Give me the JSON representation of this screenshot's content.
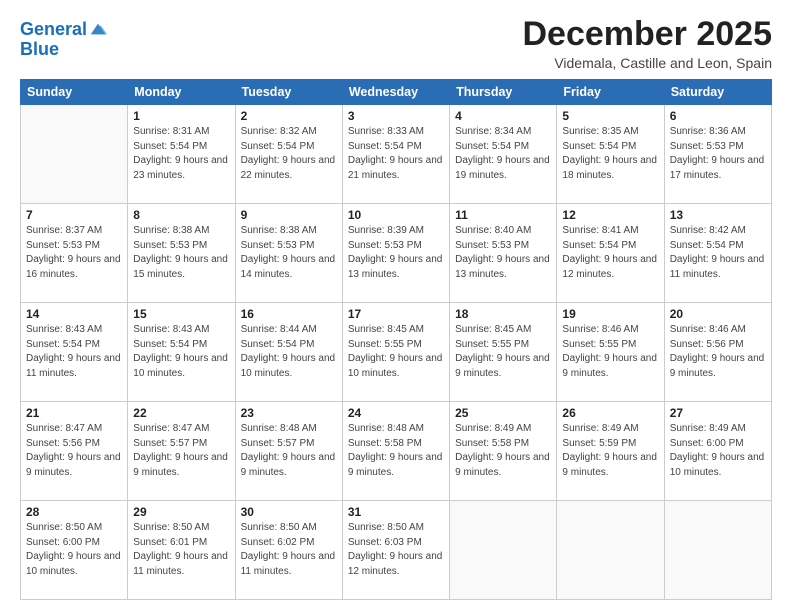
{
  "logo": {
    "line1": "General",
    "line2": "Blue"
  },
  "title": "December 2025",
  "subtitle": "Videmala, Castille and Leon, Spain",
  "weekdays": [
    "Sunday",
    "Monday",
    "Tuesday",
    "Wednesday",
    "Thursday",
    "Friday",
    "Saturday"
  ],
  "weeks": [
    [
      {
        "day": "",
        "info": ""
      },
      {
        "day": "1",
        "info": "Sunrise: 8:31 AM\nSunset: 5:54 PM\nDaylight: 9 hours\nand 23 minutes."
      },
      {
        "day": "2",
        "info": "Sunrise: 8:32 AM\nSunset: 5:54 PM\nDaylight: 9 hours\nand 22 minutes."
      },
      {
        "day": "3",
        "info": "Sunrise: 8:33 AM\nSunset: 5:54 PM\nDaylight: 9 hours\nand 21 minutes."
      },
      {
        "day": "4",
        "info": "Sunrise: 8:34 AM\nSunset: 5:54 PM\nDaylight: 9 hours\nand 19 minutes."
      },
      {
        "day": "5",
        "info": "Sunrise: 8:35 AM\nSunset: 5:54 PM\nDaylight: 9 hours\nand 18 minutes."
      },
      {
        "day": "6",
        "info": "Sunrise: 8:36 AM\nSunset: 5:53 PM\nDaylight: 9 hours\nand 17 minutes."
      }
    ],
    [
      {
        "day": "7",
        "info": "Sunrise: 8:37 AM\nSunset: 5:53 PM\nDaylight: 9 hours\nand 16 minutes."
      },
      {
        "day": "8",
        "info": "Sunrise: 8:38 AM\nSunset: 5:53 PM\nDaylight: 9 hours\nand 15 minutes."
      },
      {
        "day": "9",
        "info": "Sunrise: 8:38 AM\nSunset: 5:53 PM\nDaylight: 9 hours\nand 14 minutes."
      },
      {
        "day": "10",
        "info": "Sunrise: 8:39 AM\nSunset: 5:53 PM\nDaylight: 9 hours\nand 13 minutes."
      },
      {
        "day": "11",
        "info": "Sunrise: 8:40 AM\nSunset: 5:53 PM\nDaylight: 9 hours\nand 13 minutes."
      },
      {
        "day": "12",
        "info": "Sunrise: 8:41 AM\nSunset: 5:54 PM\nDaylight: 9 hours\nand 12 minutes."
      },
      {
        "day": "13",
        "info": "Sunrise: 8:42 AM\nSunset: 5:54 PM\nDaylight: 9 hours\nand 11 minutes."
      }
    ],
    [
      {
        "day": "14",
        "info": "Sunrise: 8:43 AM\nSunset: 5:54 PM\nDaylight: 9 hours\nand 11 minutes."
      },
      {
        "day": "15",
        "info": "Sunrise: 8:43 AM\nSunset: 5:54 PM\nDaylight: 9 hours\nand 10 minutes."
      },
      {
        "day": "16",
        "info": "Sunrise: 8:44 AM\nSunset: 5:54 PM\nDaylight: 9 hours\nand 10 minutes."
      },
      {
        "day": "17",
        "info": "Sunrise: 8:45 AM\nSunset: 5:55 PM\nDaylight: 9 hours\nand 10 minutes."
      },
      {
        "day": "18",
        "info": "Sunrise: 8:45 AM\nSunset: 5:55 PM\nDaylight: 9 hours\nand 9 minutes."
      },
      {
        "day": "19",
        "info": "Sunrise: 8:46 AM\nSunset: 5:55 PM\nDaylight: 9 hours\nand 9 minutes."
      },
      {
        "day": "20",
        "info": "Sunrise: 8:46 AM\nSunset: 5:56 PM\nDaylight: 9 hours\nand 9 minutes."
      }
    ],
    [
      {
        "day": "21",
        "info": "Sunrise: 8:47 AM\nSunset: 5:56 PM\nDaylight: 9 hours\nand 9 minutes."
      },
      {
        "day": "22",
        "info": "Sunrise: 8:47 AM\nSunset: 5:57 PM\nDaylight: 9 hours\nand 9 minutes."
      },
      {
        "day": "23",
        "info": "Sunrise: 8:48 AM\nSunset: 5:57 PM\nDaylight: 9 hours\nand 9 minutes."
      },
      {
        "day": "24",
        "info": "Sunrise: 8:48 AM\nSunset: 5:58 PM\nDaylight: 9 hours\nand 9 minutes."
      },
      {
        "day": "25",
        "info": "Sunrise: 8:49 AM\nSunset: 5:58 PM\nDaylight: 9 hours\nand 9 minutes."
      },
      {
        "day": "26",
        "info": "Sunrise: 8:49 AM\nSunset: 5:59 PM\nDaylight: 9 hours\nand 9 minutes."
      },
      {
        "day": "27",
        "info": "Sunrise: 8:49 AM\nSunset: 6:00 PM\nDaylight: 9 hours\nand 10 minutes."
      }
    ],
    [
      {
        "day": "28",
        "info": "Sunrise: 8:50 AM\nSunset: 6:00 PM\nDaylight: 9 hours\nand 10 minutes."
      },
      {
        "day": "29",
        "info": "Sunrise: 8:50 AM\nSunset: 6:01 PM\nDaylight: 9 hours\nand 11 minutes."
      },
      {
        "day": "30",
        "info": "Sunrise: 8:50 AM\nSunset: 6:02 PM\nDaylight: 9 hours\nand 11 minutes."
      },
      {
        "day": "31",
        "info": "Sunrise: 8:50 AM\nSunset: 6:03 PM\nDaylight: 9 hours\nand 12 minutes."
      },
      {
        "day": "",
        "info": ""
      },
      {
        "day": "",
        "info": ""
      },
      {
        "day": "",
        "info": ""
      }
    ]
  ]
}
